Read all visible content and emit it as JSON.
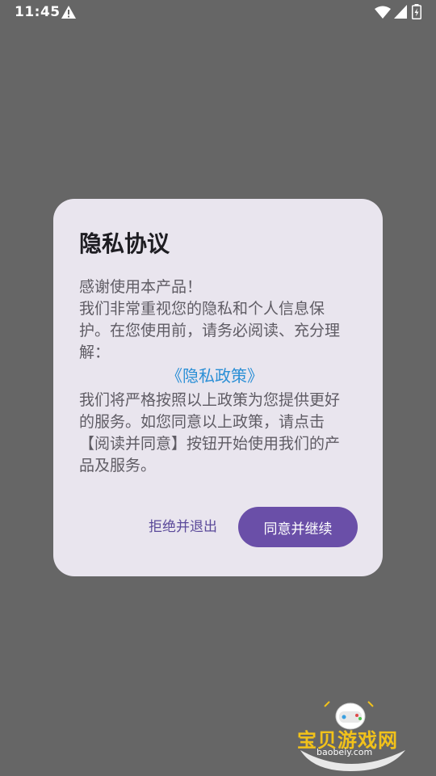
{
  "status_bar": {
    "time": "11:45"
  },
  "dialog": {
    "title": "隐私协议",
    "paragraph_1": "感谢使用本产品！\n我们非常重视您的隐私和个人信息保护。在您使用前，请务必阅读、充分理解：",
    "policy_link": "《隐私政策》",
    "paragraph_2": "我们将严格按照以上政策为您提供更好的服务。如您同意以上政策，请点击【阅读并同意】按钮开始使用我们的产品及服务。",
    "reject_label": "拒绝并退出",
    "agree_label": "同意并继续"
  },
  "watermark": {
    "name": "宝贝游戏网",
    "url": "baobeiy.com"
  },
  "colors": {
    "overlay_bg": "#666666",
    "dialog_bg": "#e9e5ee",
    "accent": "#6a4fa8",
    "link": "#2b8fd6"
  }
}
